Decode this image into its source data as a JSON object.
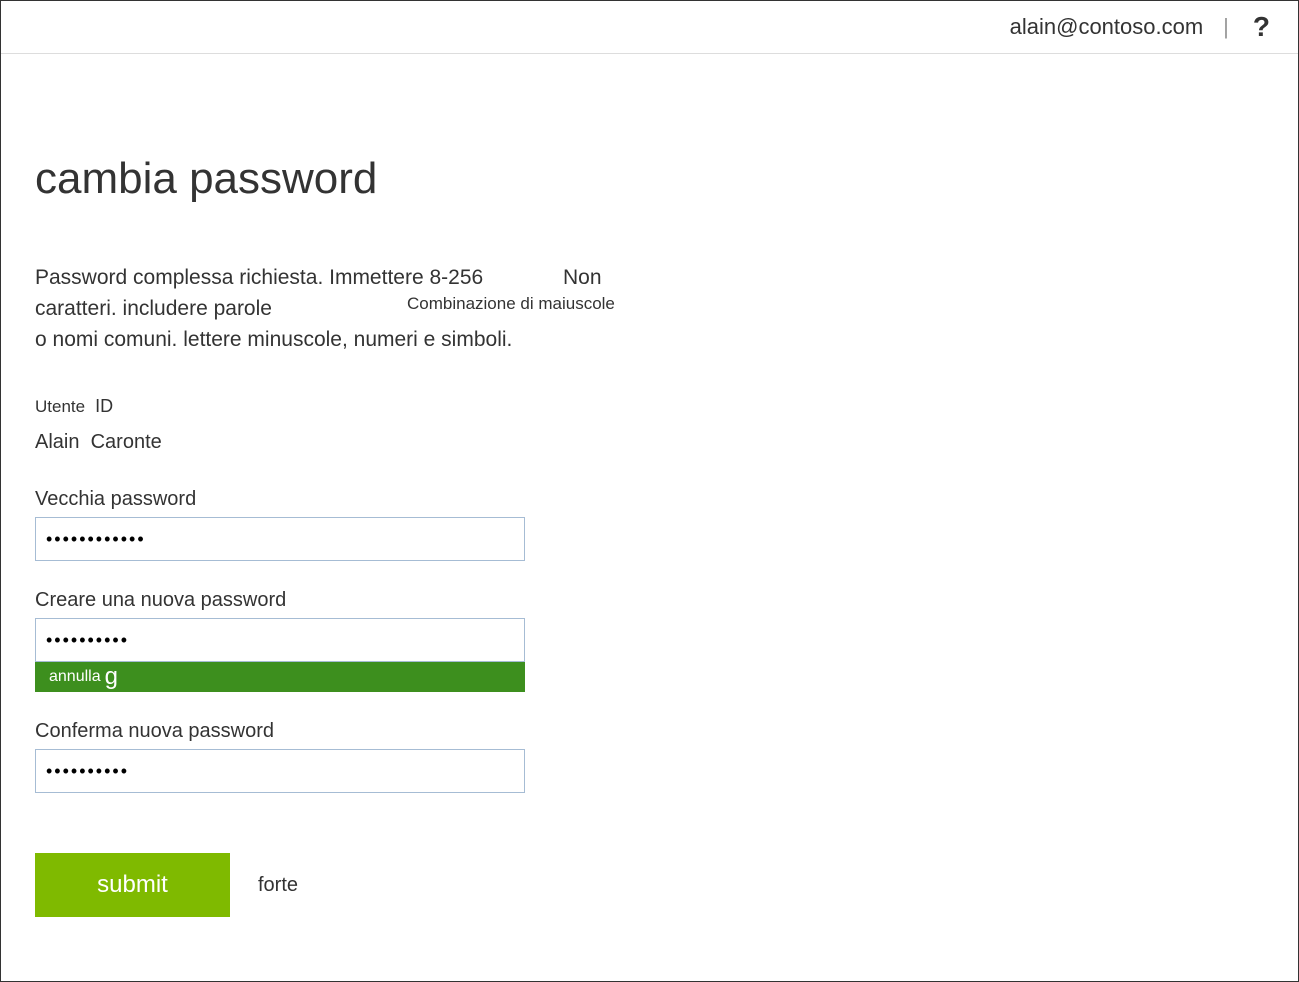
{
  "header": {
    "email": "alain@contoso.com",
    "divider": "|",
    "help": "?"
  },
  "page": {
    "title": "cambia password"
  },
  "description": {
    "line1a": "Password complessa richiesta. Immettere 8-256",
    "line1b": "Non",
    "line2a": "caratteri. includere parole",
    "line2b": "Combinazione di maiuscole",
    "line3": "o nomi comuni. lettere minuscole, numeri e simboli."
  },
  "user": {
    "label_utente": "Utente",
    "label_id": "ID",
    "name_first": "Alain",
    "name_last": "Caronte"
  },
  "form": {
    "old_password_label": "Vecchia password",
    "old_password_value": "••••••••••••",
    "new_password_label": "Creare una nuova password",
    "new_password_value": "••••••••••",
    "strength_bar_text": "annulla",
    "strength_bar_g": "g",
    "confirm_password_label": "Conferma nuova password",
    "confirm_password_value": "••••••••••"
  },
  "actions": {
    "submit_label": "submit",
    "strength_word": "forte"
  }
}
